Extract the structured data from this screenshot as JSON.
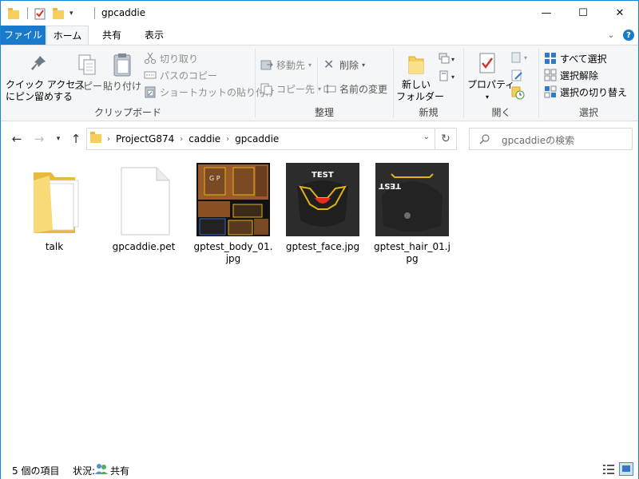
{
  "window": {
    "title": "gpcaddie",
    "caption_minimize": "—",
    "caption_maximize": "☐",
    "caption_close": "✕"
  },
  "tabs": {
    "file": "ファイル",
    "home": "ホーム",
    "share": "共有",
    "view": "表示",
    "expand_glyph": "⌄",
    "help_glyph": "?"
  },
  "ribbon": {
    "clipboard": {
      "label": "クリップボード",
      "pin_line1": "クイック アクセス",
      "pin_line2": "にピン留めする",
      "copy": "コピー",
      "paste": "貼り付け",
      "cut": "切り取り",
      "copy_path": "パスのコピー",
      "paste_shortcut": "ショートカットの貼り付け"
    },
    "organize": {
      "label": "整理",
      "move_to": "移動先",
      "copy_to": "コピー先",
      "delete": "削除",
      "rename": "名前の変更"
    },
    "new": {
      "label": "新規",
      "new_folder_line1": "新しい",
      "new_folder_line2": "フォルダー"
    },
    "open": {
      "label": "開く",
      "properties": "プロパティ"
    },
    "select": {
      "label": "選択",
      "select_all": "すべて選択",
      "select_none": "選択解除",
      "invert": "選択の切り替え"
    }
  },
  "address": {
    "crumbs": [
      "ProjectG874",
      "caddie",
      "gpcaddie"
    ],
    "search_placeholder": "gpcaddieの検索"
  },
  "files": [
    {
      "name": "talk",
      "kind": "folder"
    },
    {
      "name": "gpcaddie.pet",
      "kind": "document"
    },
    {
      "name": "gptest_body_01.jpg",
      "kind": "image-body",
      "thumb_text": "G P"
    },
    {
      "name": "gptest_face.jpg",
      "kind": "image-face",
      "thumb_text": "TEST"
    },
    {
      "name": "gptest_hair_01.jpg",
      "kind": "image-hair",
      "thumb_text": "TEST"
    }
  ],
  "status": {
    "count": "5 個の項目",
    "state_label": "状況:",
    "state_value": "共有"
  },
  "colors": {
    "accent": "#1979ca",
    "folder": "#f6cf5a",
    "thumb_bg": "#2b2b2b",
    "thumb_line": "#e2b313"
  }
}
